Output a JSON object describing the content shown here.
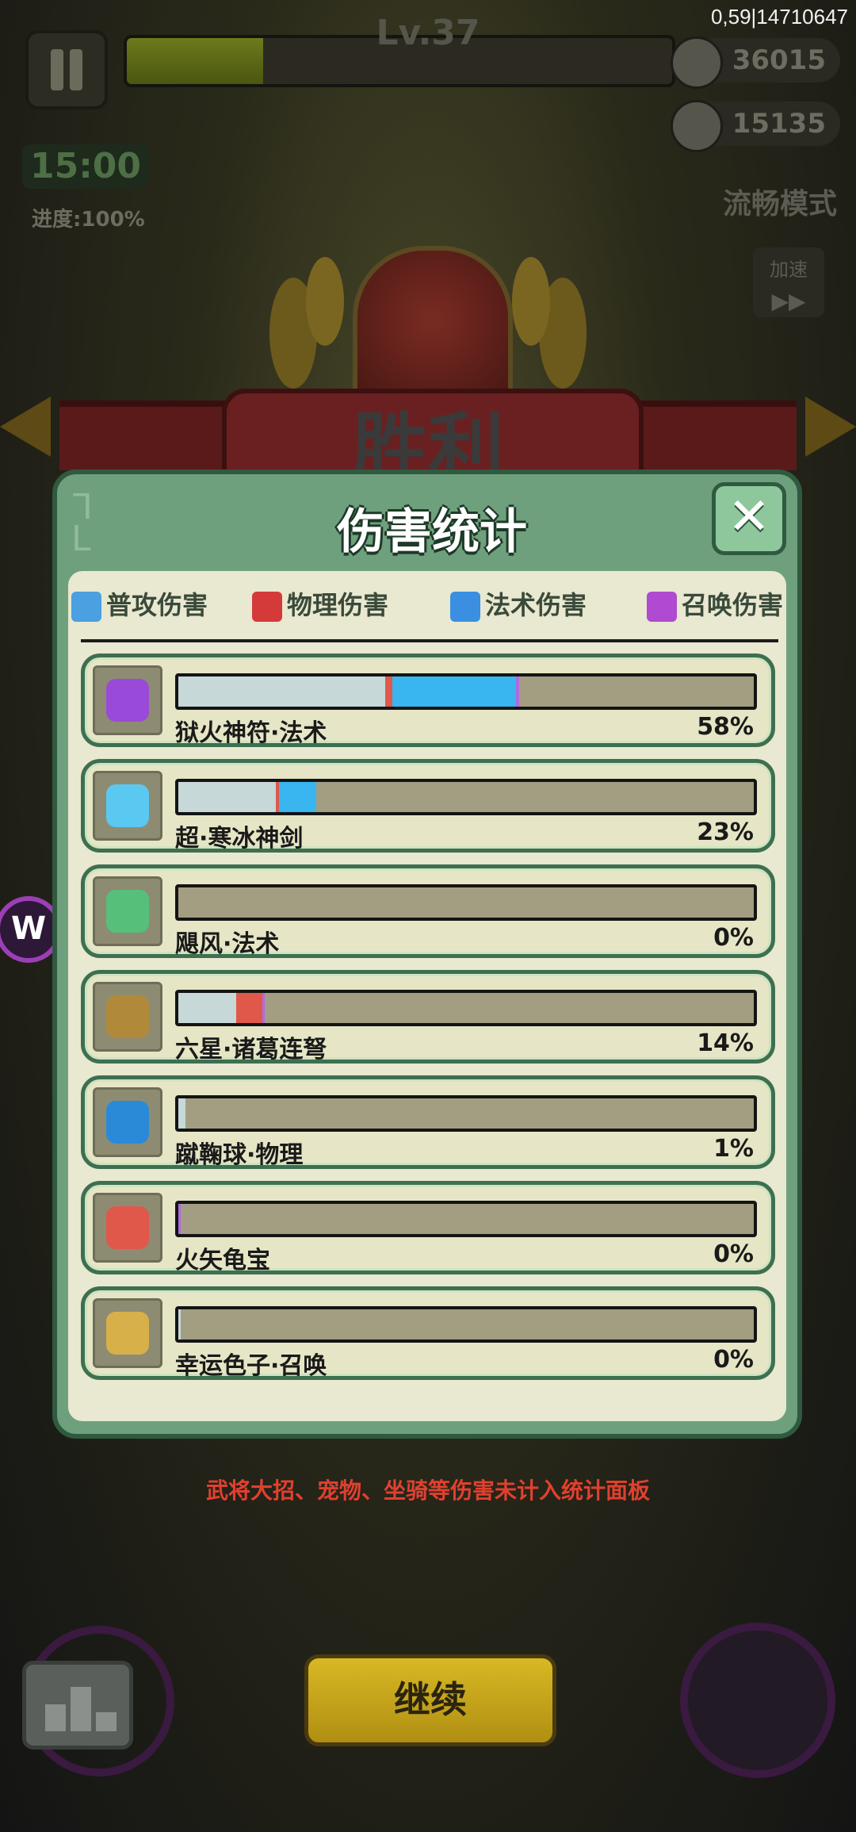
{
  "hud": {
    "level": "Lv.37",
    "xp_progress": 0.25,
    "coords": "0,59|14710647",
    "coins": "36015",
    "kills": "15135",
    "timer": "15:00",
    "progress": "进度:100%",
    "mode": "流畅模式",
    "speed": "加速",
    "speed_icon": "fast-forward-icon"
  },
  "banner": {
    "title": "胜利"
  },
  "panel": {
    "title": "伤害统计",
    "close_icon": "close-icon",
    "tabs": [
      {
        "label": "普攻伤害",
        "icon": "sword-icon",
        "color": "#4aa0e0"
      },
      {
        "label": "物理伤害",
        "icon": "axe-icon",
        "color": "#d43a3a"
      },
      {
        "label": "法术伤害",
        "icon": "flame-icon",
        "color": "#3a8fe0"
      },
      {
        "label": "召唤伤害",
        "icon": "paw-icon",
        "color": "#b04ad0"
      }
    ],
    "rows": [
      {
        "name": "狱火神符·法术",
        "pct": "58%",
        "icon": "talisman-icon",
        "icon_color": "#9a4ad8",
        "segments": [
          {
            "share": 0.36,
            "color": "#c6d8d8"
          },
          {
            "share": 0.012,
            "color": "#e0584a"
          },
          {
            "share": 0.215,
            "color": "#39b6f0"
          },
          {
            "share": 0.006,
            "color": "#b06ae0"
          }
        ]
      },
      {
        "name": "超·寒冰神剑",
        "pct": "23%",
        "icon": "ice-sword-icon",
        "icon_color": "#5ac8f0",
        "segments": [
          {
            "share": 0.17,
            "color": "#c6d8d8"
          },
          {
            "share": 0.005,
            "color": "#e0584a"
          },
          {
            "share": 0.065,
            "color": "#39b6f0"
          }
        ]
      },
      {
        "name": "飓风·法术",
        "pct": "0%",
        "icon": "tornado-icon",
        "icon_color": "#56c07a",
        "segments": []
      },
      {
        "name": "六星·诸葛连弩",
        "pct": "14%",
        "icon": "crossbow-icon",
        "icon_color": "#b08a3a",
        "segments": [
          {
            "share": 0.1,
            "color": "#c6d8d8"
          },
          {
            "share": 0.045,
            "color": "#e0584a"
          },
          {
            "share": 0.004,
            "color": "#b06ae0"
          }
        ]
      },
      {
        "name": "蹴鞠球·物理",
        "pct": "1%",
        "icon": "ball-icon",
        "icon_color": "#2a8ad8",
        "segments": [
          {
            "share": 0.013,
            "color": "#c6d8d8"
          }
        ]
      },
      {
        "name": "火矢龟宝",
        "pct": "0%",
        "icon": "fire-turtle-icon",
        "icon_color": "#e0584a",
        "segments": [
          {
            "share": 0.004,
            "color": "#b06ae0"
          }
        ]
      },
      {
        "name": "幸运色子·召唤",
        "pct": "0%",
        "icon": "dice-icon",
        "icon_color": "#d8b04a",
        "segments": [
          {
            "share": 0.004,
            "color": "#c6d8d8"
          }
        ]
      }
    ]
  },
  "note": "武将大招、宠物、坐骑等伤害未计入统计面板",
  "continue_label": "继续",
  "leaderboard_icon": "leaderboard-icon",
  "w_badge": "W"
}
